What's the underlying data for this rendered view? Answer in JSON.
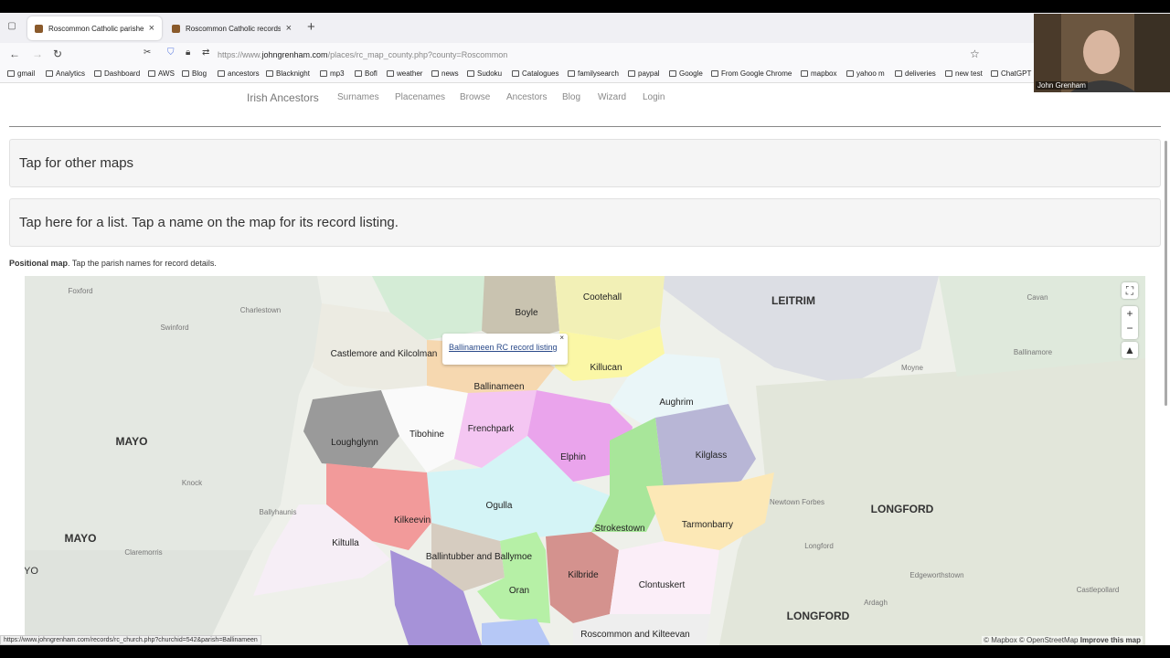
{
  "browser": {
    "tabs": [
      {
        "title": "Roscommon Catholic parishes",
        "close": "×"
      },
      {
        "title": "Roscommon Catholic records",
        "close": "×"
      }
    ],
    "new_tab": "+",
    "url_prefix": "https://www.",
    "url_domain": "johngrenham.com",
    "url_path": "/places/rc_map_county.php?county=Roscommon",
    "bookmarks": [
      "gmail",
      "Analytics",
      "Dashboard",
      "AWS",
      "Blog",
      "ancestors",
      "Blacknight",
      "mp3",
      "Bofl",
      "weather",
      "news",
      "Sudoku",
      "Catalogues",
      "familysearch",
      "paypal",
      "Google",
      "From Google Chrome",
      "mapbox",
      "yahoo m",
      "deliveries",
      "new test",
      "ChatGPT"
    ]
  },
  "site": {
    "brand": "Irish Ancestors",
    "nav": [
      "Surnames",
      "Placenames",
      "Browse",
      "Ancestors",
      "Blog",
      "Wizard",
      "Login"
    ]
  },
  "panels": {
    "other_maps": "Tap for other maps",
    "list_hint": "Tap here for a list. Tap a name on the map for its record listing."
  },
  "positional": {
    "bold": "Positional map",
    "text": ". Tap the parish names for record details."
  },
  "map": {
    "parishes": [
      "Boyle",
      "Cootehall",
      "Castlemore and Kilcolman",
      "Ballinameen",
      "Killucan",
      "Aughrim",
      "Loughglynn",
      "Tibohine",
      "Frenchpark",
      "Elphin",
      "Kilglass",
      "Ogulla",
      "Kilkeevin",
      "Strokestown",
      "Tarmonbarry",
      "Kiltulla",
      "Ballintubber and Ballymoe",
      "Oran",
      "Kilbride",
      "Clontuskert",
      "Roscommon and Kilteevan"
    ],
    "counties": [
      "LEITRIM",
      "MAYO",
      "MAYO",
      "LONGFORD",
      "LONGFORD",
      "YO"
    ],
    "towns": [
      "Foxford",
      "Charlestown",
      "Swinford",
      "Knock",
      "Ballyhaunis",
      "Claremorris",
      "Moyne",
      "Ballinamore",
      "Cavan",
      "Newtown Forbes",
      "Longford",
      "Edgeworthstown",
      "Ardagh",
      "Castlepollard"
    ],
    "popup_link": "Ballinameen RC record listing",
    "popup_close": "×",
    "attribution": "© Mapbox © OpenStreetMap",
    "improve": "Improve this map",
    "zoom_in": "+",
    "zoom_out": "−"
  },
  "status_url": "https://www.johngrenham.com/records/rc_church.php?churchid=542&parish=Ballinameen",
  "webcam": {
    "name": "John Grenham"
  }
}
